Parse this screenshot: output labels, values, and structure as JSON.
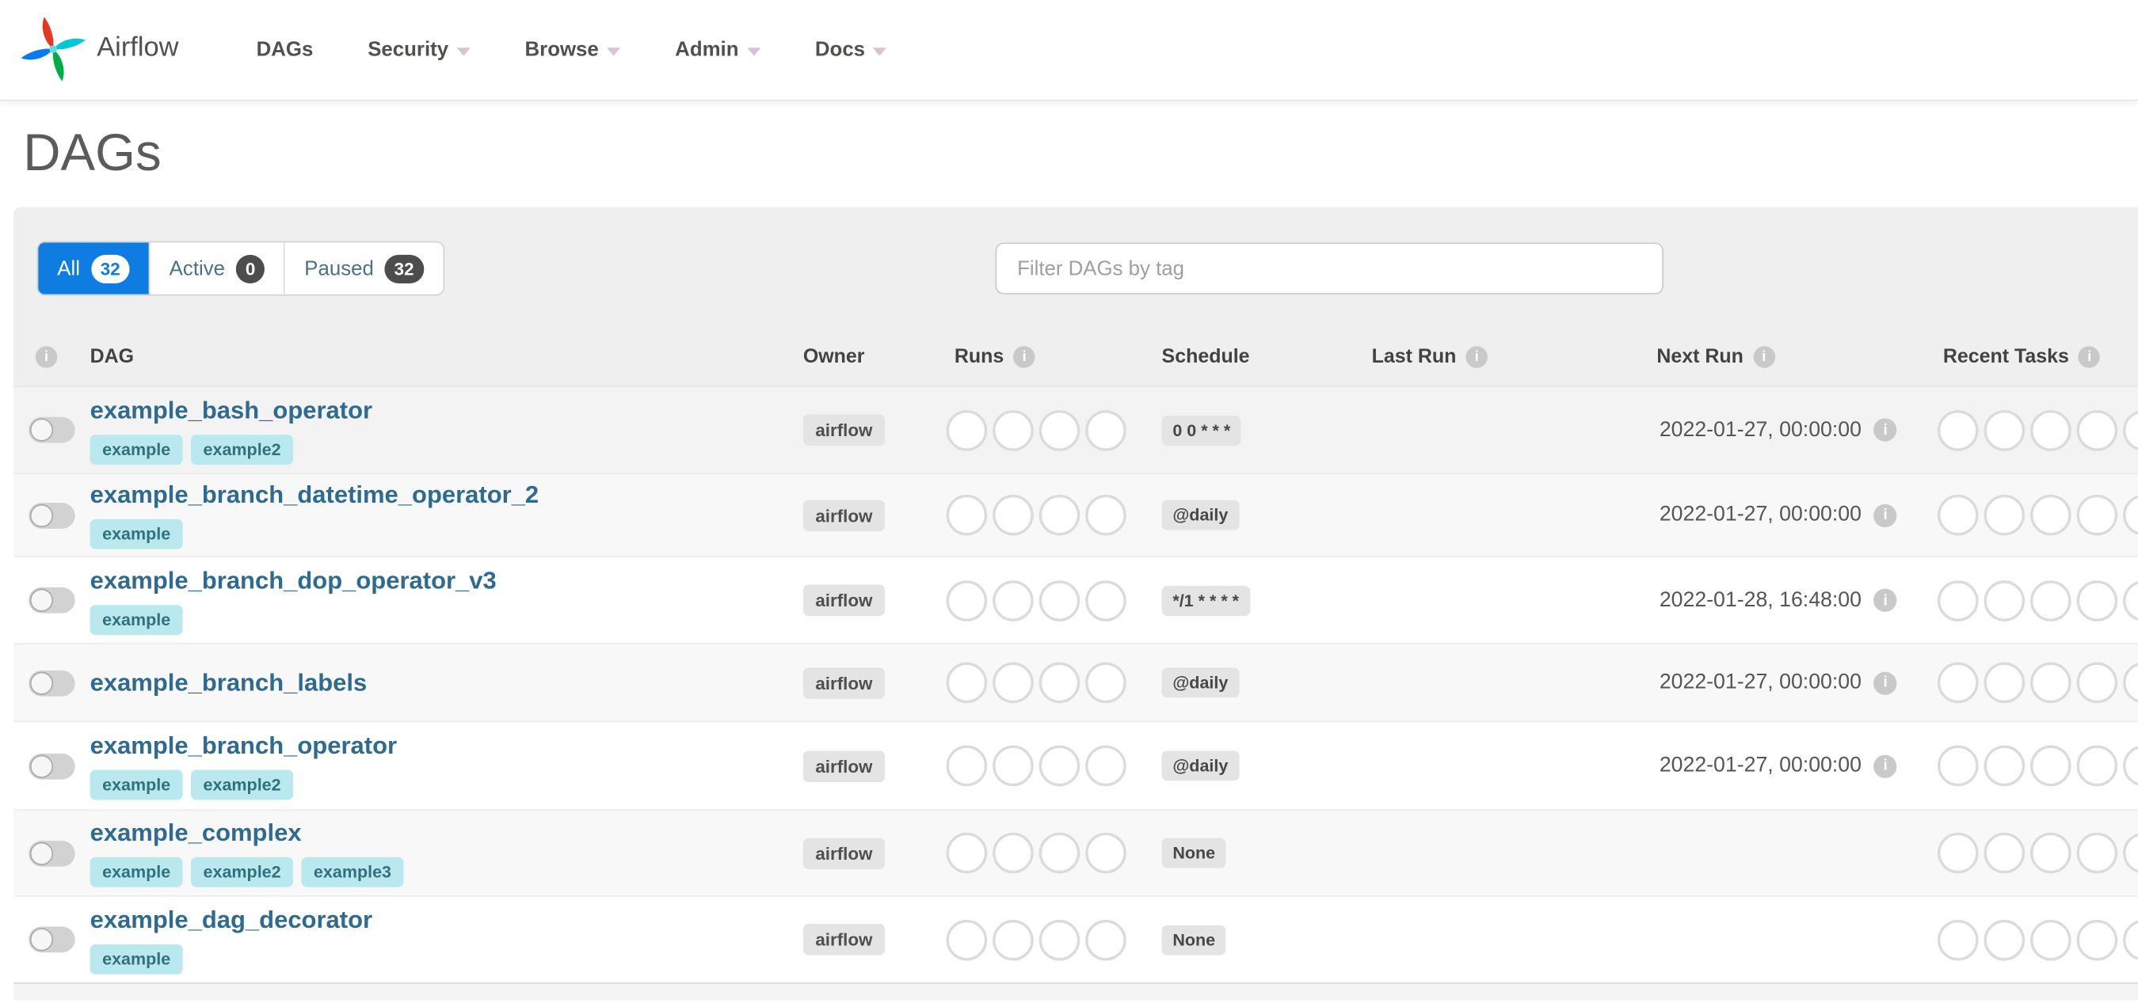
{
  "navbar": {
    "brand": "Airflow",
    "items": [
      {
        "label": "DAGs",
        "caret": false
      },
      {
        "label": "Security",
        "caret": true
      },
      {
        "label": "Browse",
        "caret": true
      },
      {
        "label": "Admin",
        "caret": true
      },
      {
        "label": "Docs",
        "caret": true
      }
    ]
  },
  "page": {
    "title": "DAGs"
  },
  "controls": {
    "tabs": [
      {
        "label": "All",
        "count": "32",
        "active": true
      },
      {
        "label": "Active",
        "count": "0",
        "active": false
      },
      {
        "label": "Paused",
        "count": "32",
        "active": false
      }
    ],
    "filter_placeholder": "Filter DAGs by tag"
  },
  "table": {
    "headers": {
      "dag": "DAG",
      "owner": "Owner",
      "runs": "Runs",
      "schedule": "Schedule",
      "last_run": "Last Run",
      "next_run": "Next Run",
      "recent_tasks": "Recent Tasks"
    },
    "runs_slots": 4,
    "recent_slots": 5,
    "rows": [
      {
        "name": "example_bash_operator",
        "tags": [
          "example",
          "example2"
        ],
        "owner": "airflow",
        "schedule": "0 0 * * *",
        "last_run": "",
        "next_run": "2022-01-27, 00:00:00"
      },
      {
        "name": "example_branch_datetime_operator_2",
        "tags": [
          "example"
        ],
        "owner": "airflow",
        "schedule": "@daily",
        "last_run": "",
        "next_run": "2022-01-27, 00:00:00"
      },
      {
        "name": "example_branch_dop_operator_v3",
        "tags": [
          "example"
        ],
        "owner": "airflow",
        "schedule": "*/1 * * * *",
        "last_run": "",
        "next_run": "2022-01-28, 16:48:00"
      },
      {
        "name": "example_branch_labels",
        "tags": [],
        "owner": "airflow",
        "schedule": "@daily",
        "last_run": "",
        "next_run": "2022-01-27, 00:00:00"
      },
      {
        "name": "example_branch_operator",
        "tags": [
          "example",
          "example2"
        ],
        "owner": "airflow",
        "schedule": "@daily",
        "last_run": "",
        "next_run": "2022-01-27, 00:00:00"
      },
      {
        "name": "example_complex",
        "tags": [
          "example",
          "example2",
          "example3"
        ],
        "owner": "airflow",
        "schedule": "None",
        "last_run": "",
        "next_run": ""
      },
      {
        "name": "example_dag_decorator",
        "tags": [
          "example"
        ],
        "owner": "airflow",
        "schedule": "None",
        "last_run": "",
        "next_run": ""
      }
    ]
  },
  "icons": {
    "info_glyph": "i"
  },
  "colors": {
    "accent_blue": "#0e7ce1",
    "nav_text": "#51504f",
    "dag_link": "#2f6a8f",
    "tag_bg": "#b9e9ee",
    "tag_text": "#33707d",
    "logo_red": "#e43921",
    "logo_teal": "#00c7d4",
    "logo_blue": "#087cee",
    "logo_green": "#00ad46"
  }
}
